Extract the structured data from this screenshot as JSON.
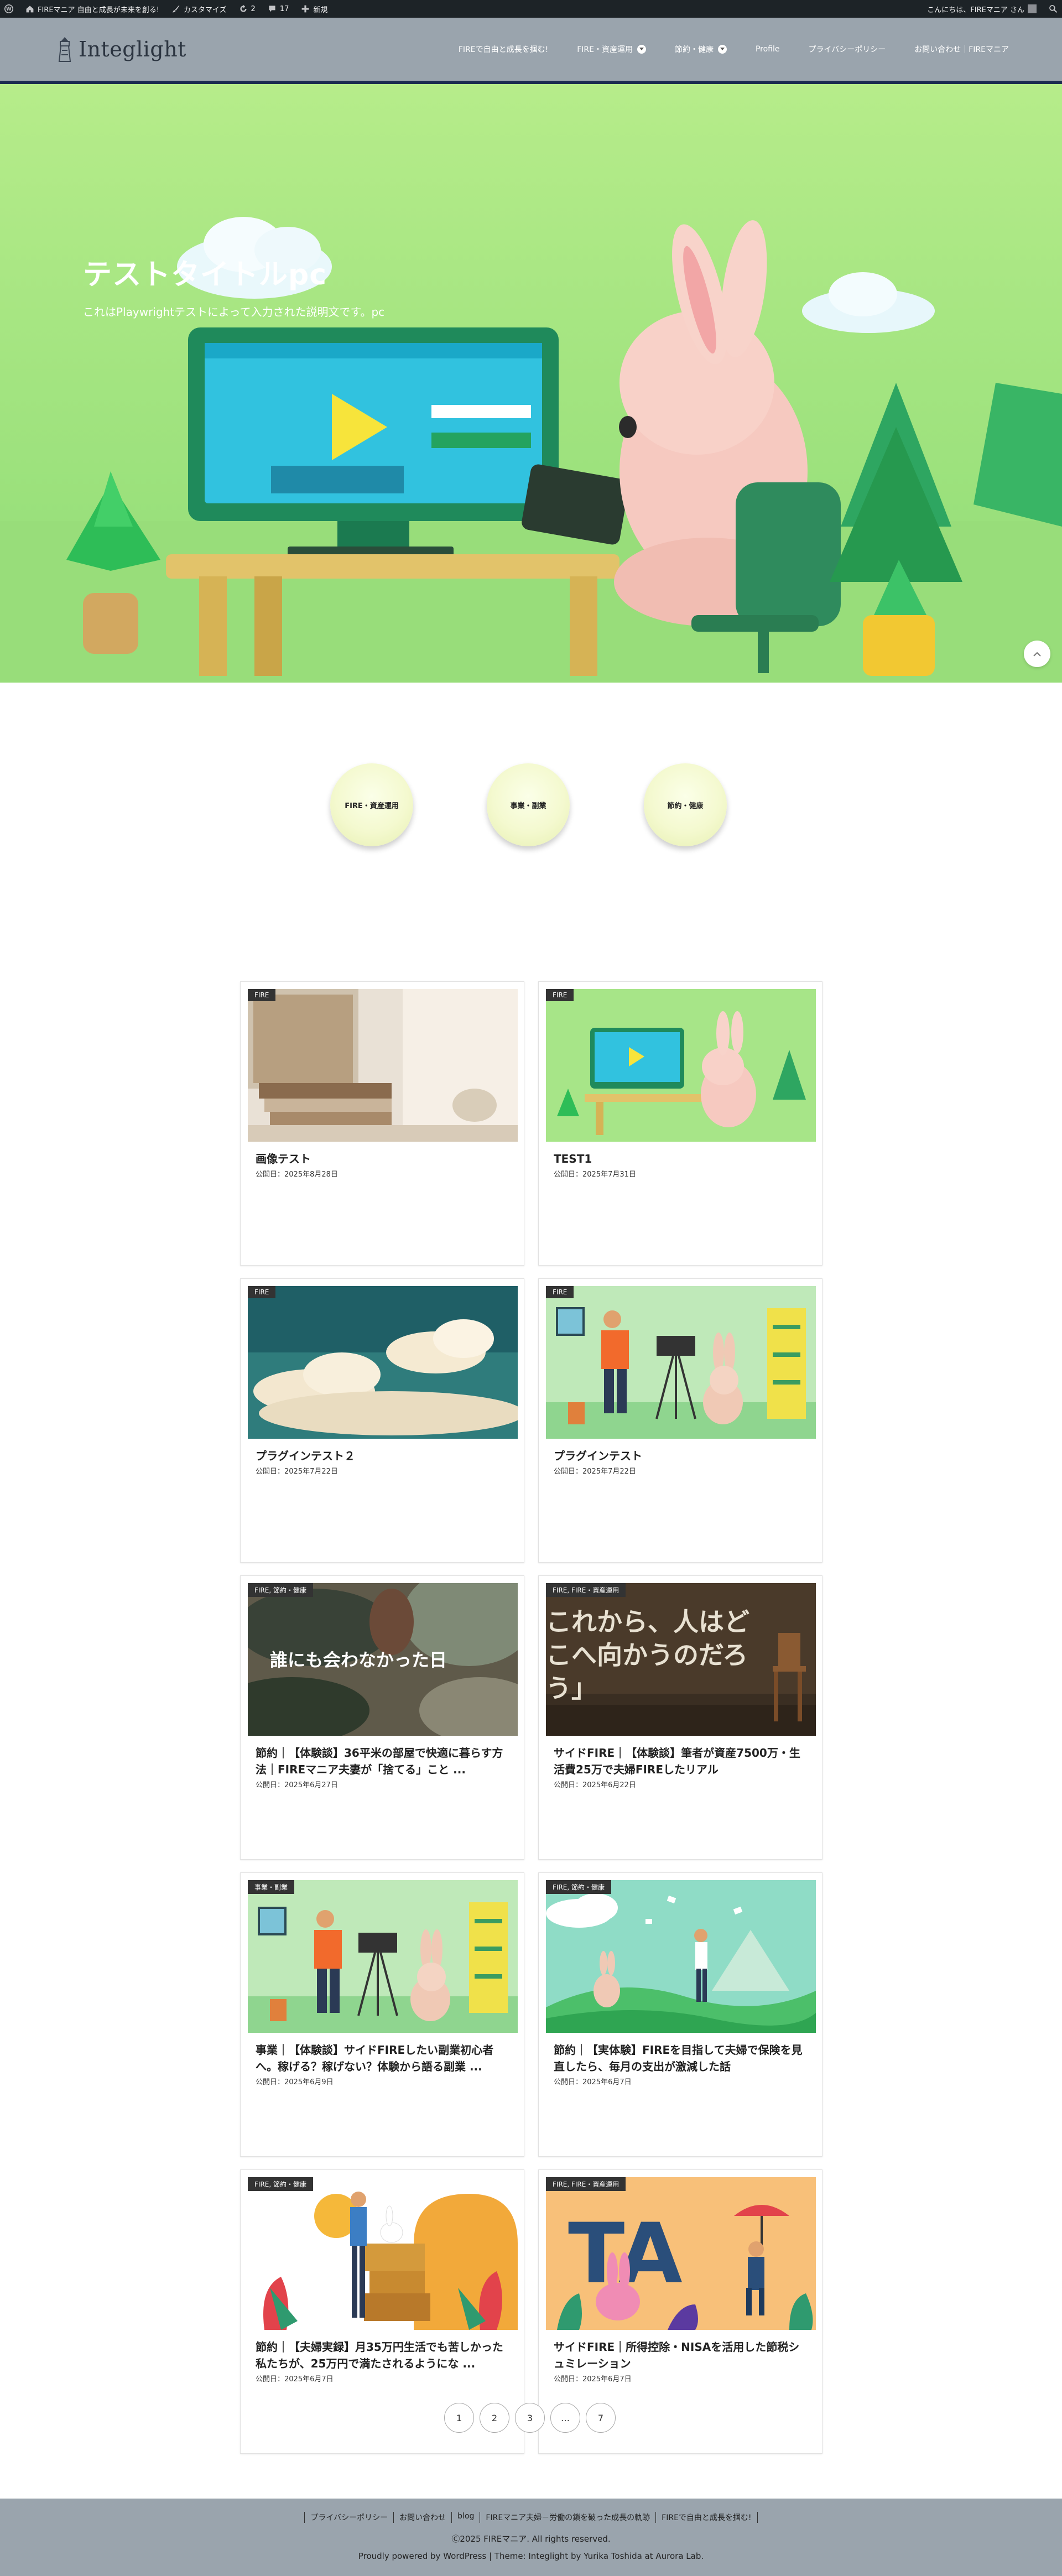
{
  "admin_bar": {
    "site_name": "FIREマニア 自由と成長が未来を創る!",
    "customize": "カスタマイズ",
    "updates": "2",
    "comments": "17",
    "new": "新規",
    "greeting": "こんにちは、FIREマニア さん"
  },
  "header": {
    "logo_text": "Integlight",
    "nav": [
      {
        "label": "FIREで自由と成長を掴む!"
      },
      {
        "label": "FIRE・資産運用"
      },
      {
        "label": "節約・健康"
      },
      {
        "label": "Profile"
      },
      {
        "label": "プライバシーポリシー"
      },
      {
        "label": "お問い合わせ｜FIREマニア"
      }
    ]
  },
  "hero": {
    "title": "テストタイトルpc",
    "description": "これはPlaywrightテストによって入力された説明文です。pc"
  },
  "categories": [
    {
      "label": "FIRE・資産運用"
    },
    {
      "label": "事業・副業"
    },
    {
      "label": "節約・健康"
    }
  ],
  "posts": [
    {
      "tag": "FIRE",
      "title": "画像テスト",
      "date": "公開日：2025年8月28日"
    },
    {
      "tag": "FIRE",
      "title": "TEST1",
      "date": "公開日：2025年7月31日"
    },
    {
      "tag": "FIRE",
      "title": "プラグインテスト２",
      "date": "公開日：2025年7月22日"
    },
    {
      "tag": "FIRE",
      "title": "プラグインテスト",
      "date": "公開日：2025年7月22日"
    },
    {
      "tag": "FIRE, 節約・健康",
      "title": "節約｜【体験談】36平米の部屋で快適に暮らす方法｜FIREマニア夫妻が「捨てる」こと ...",
      "date": "公開日：2025年6月27日",
      "overlay": "誰にも会わなかった日"
    },
    {
      "tag": "FIRE, FIRE・資産運用",
      "title": "サイドFIRE｜【体験談】筆者が資産7500万・生活費25万で夫婦FIREしたリアル",
      "date": "公開日：2025年6月22日",
      "overlay": "これから、人はどこへ向かうのだろう」"
    },
    {
      "tag": "事業・副業",
      "title": "事業｜【体験談】サイドFIREしたい副業初心者へ。稼げる？稼げない？体験から語る副業 ...",
      "date": "公開日：2025年6月9日"
    },
    {
      "tag": "FIRE, 節約・健康",
      "title": "節約｜【実体験】FIREを目指して夫婦で保険を見直したら、毎月の支出が激減した話",
      "date": "公開日：2025年6月7日"
    },
    {
      "tag": "FIRE, 節約・健康",
      "title": "節約｜【夫婦実録】月35万円生活でも苦しかった私たちが、25万円で満たされるようにな ...",
      "date": "公開日：2025年6月7日"
    },
    {
      "tag": "FIRE, FIRE・資産運用",
      "title": "サイドFIRE｜所得控除・NISAを活用した節税シュミレーション",
      "date": "公開日：2025年6月7日"
    }
  ],
  "pagination": [
    "1",
    "2",
    "3",
    "…",
    "7"
  ],
  "footer": {
    "links": [
      "プライバシーポリシー",
      "お問い合わせ",
      "blog",
      "FIREマニア夫婦－労働の鎖を破った成長の軌跡",
      "FIREで自由と成長を掴む!"
    ],
    "copyright": "Ⓒ2025 FIREマニア. All rights reserved.",
    "powered": "Proudly powered by WordPress | Theme: Integlight by Yurika Toshida at Aurora Lab."
  },
  "colors": {
    "header_bg": "#9aa4ad",
    "admin_bg": "#1d2327",
    "header_rule": "#1b2c50",
    "hero_bg": "#a6e886",
    "tag_bg": "#333333",
    "category_circle": "#f4f9cf"
  },
  "icons": [
    "wordpress-icon",
    "home-icon",
    "brush-icon",
    "refresh-icon",
    "comment-icon",
    "plus-icon",
    "search-icon",
    "lighthouse-logo-icon",
    "chevron-down-icon",
    "chevron-up-icon"
  ]
}
